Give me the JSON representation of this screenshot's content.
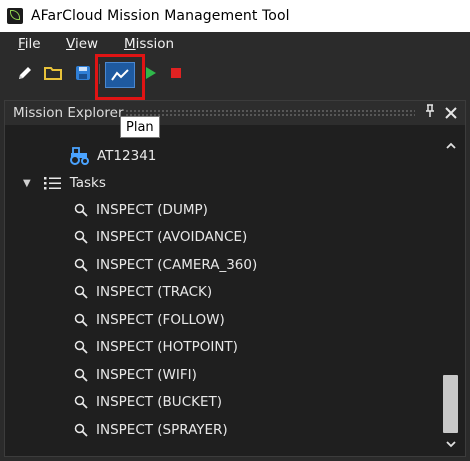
{
  "window": {
    "title": "AFarCloud Mission Management Tool",
    "app_icon": "afarcloud-leaf-icon"
  },
  "menu": {
    "file": {
      "underline": "F",
      "rest": "ile"
    },
    "view": {
      "underline": "V",
      "rest": "iew"
    },
    "mission": {
      "underline": "M",
      "rest": "ission"
    }
  },
  "toolbar": {
    "buttons": [
      "edit-icon",
      "open-folder-icon",
      "save-icon",
      "plan-icon",
      "play-icon",
      "stop-icon"
    ],
    "colors": {
      "folder": "#e8c23a",
      "save": "#2f7fd6",
      "plan_bg": "#1e5aa0",
      "play": "#2fb84a",
      "stop": "#e02222",
      "highlight": "#e01414"
    }
  },
  "tooltip": {
    "text": "Plan"
  },
  "panel": {
    "title": "Mission Explorer",
    "vehicle": {
      "label": "AT12341",
      "icon": "tractor-icon"
    },
    "tasks_label": "Tasks",
    "tasks": [
      "INSPECT (DUMP)",
      "INSPECT (AVOIDANCE)",
      "INSPECT (CAMERA_360)",
      "INSPECT (TRACK)",
      "INSPECT (FOLLOW)",
      "INSPECT (HOTPOINT)",
      "INSPECT (WIFI)",
      "INSPECT (BUCKET)",
      "INSPECT (SPRAYER)"
    ]
  }
}
